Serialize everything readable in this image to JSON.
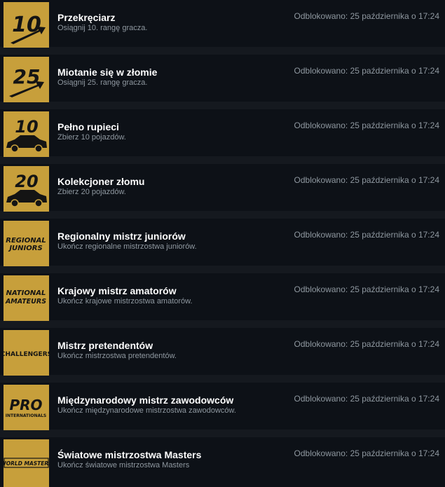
{
  "unlock_text": "Odblokowano: 25 października o 17:24",
  "achievements": [
    {
      "title": "Przekręciarz",
      "desc": "Osiągnij 10. rangę gracza.",
      "icon": "rank-10-arrow-icon",
      "icon_text": "10"
    },
    {
      "title": "Miotanie się w złomie",
      "desc": "Osiągnij 25. rangę gracza.",
      "icon": "rank-25-arrow-icon",
      "icon_text": "25"
    },
    {
      "title": "Pełno rupieci",
      "desc": "Zbierz 10 pojazdów.",
      "icon": "car-10-icon",
      "icon_text": "10"
    },
    {
      "title": "Kolekcjoner złomu",
      "desc": "Zbierz 20 pojazdów.",
      "icon": "car-20-icon",
      "icon_text": "20"
    },
    {
      "title": "Regionalny mistrz juniorów",
      "desc": "Ukończ regionalne mistrzostwa juniorów.",
      "icon": "regional-juniors-logo-icon",
      "icon_text": "REGIONAL JUNIORS"
    },
    {
      "title": "Krajowy mistrz amatorów",
      "desc": "Ukończ krajowe mistrzostwa amatorów.",
      "icon": "national-amateurs-logo-icon",
      "icon_text": "NATIONAL AMATEURS"
    },
    {
      "title": "Mistrz pretendentów",
      "desc": "Ukończ mistrzostwa pretendentów.",
      "icon": "challengers-logo-icon",
      "icon_text": "CHALLENGERS"
    },
    {
      "title": "Międzynarodowy mistrz zawodowców",
      "desc": "Ukończ międzynarodowe mistrzostwa zawodowców.",
      "icon": "pro-internationals-logo-icon",
      "icon_text": "PRO INTERNATIONALS"
    },
    {
      "title": "Światowe mistrzostwa Masters",
      "desc": "Ukończ światowe mistrzostwa Masters",
      "icon": "world-masters-logo-icon",
      "icon_text": "WORLD MASTERS"
    }
  ]
}
